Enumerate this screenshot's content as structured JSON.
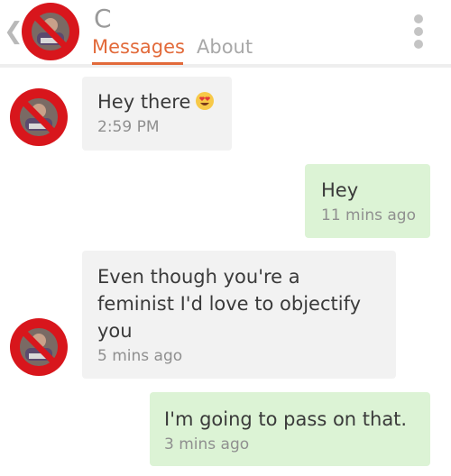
{
  "header": {
    "back_icon": "chevron-left-icon",
    "contact_name": "C",
    "tabs": [
      {
        "label": "Messages",
        "active": true
      },
      {
        "label": "About",
        "active": false
      }
    ],
    "menu_icon": "kebab-menu-icon",
    "accent_color": "#e26a3a"
  },
  "messages": [
    {
      "direction": "incoming",
      "text": "Hey there",
      "emoji": "heart-eyes-emoji",
      "time": "2:59 PM"
    },
    {
      "direction": "outgoing",
      "text": "Hey",
      "time": "11 mins ago"
    },
    {
      "direction": "incoming",
      "lines": [
        "Even though you're a",
        "feminist I'd love to objectify",
        "you"
      ],
      "time": "5 mins ago"
    },
    {
      "direction": "outgoing",
      "text": "I'm going to pass on that.",
      "time": "3 mins ago"
    }
  ],
  "colors": {
    "incoming_bubble": "#f2f2f2",
    "outgoing_bubble": "#dcf3d5",
    "prohibition_sign": "#d8161c"
  }
}
